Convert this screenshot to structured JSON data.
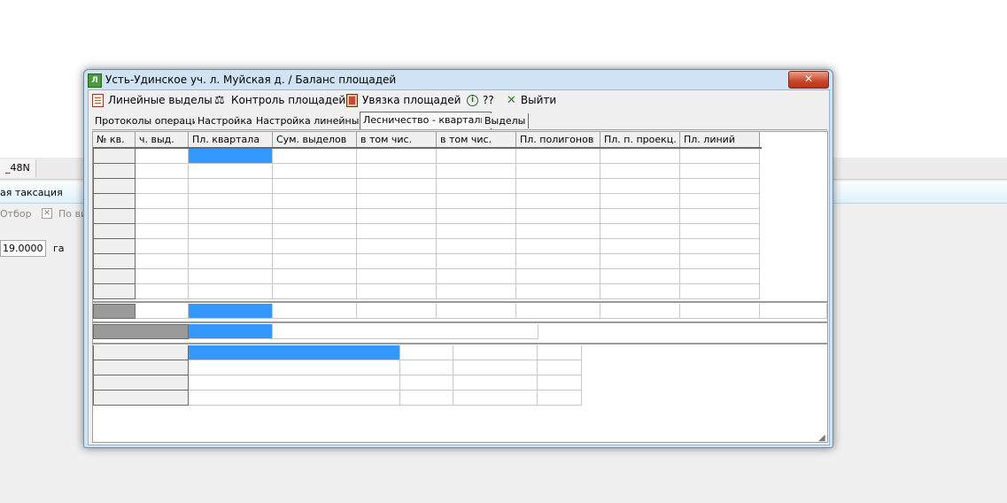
{
  "background": {
    "tab_label": "_48N",
    "bar_label": "ая таксация",
    "filter_label": "Отбор",
    "filter_check_label": "По ви",
    "area_value": "19.0000",
    "area_unit": "га"
  },
  "window": {
    "title": "Усть-Удинское уч. л. Муйская д. / Баланс площадей",
    "close_glyph": "✕",
    "menu": [
      {
        "label": "Линейные выделы",
        "icon": "document-icon"
      },
      {
        "label": "Контроль площадей",
        "icon": "scales-icon"
      },
      {
        "label": "Увязка площадей",
        "icon": "ledger-icon"
      },
      {
        "label": "??",
        "icon": "info-icon"
      },
      {
        "label": "Выйти",
        "icon": "exit-x-icon"
      }
    ],
    "tabs": [
      {
        "label": "Протоколы операций"
      },
      {
        "label": "Настройка"
      },
      {
        "label": "Настройка линейных"
      },
      {
        "label": "Лесничество - кварталы",
        "active": true
      },
      {
        "label": "Выделы"
      }
    ],
    "columns": [
      "№ кв.",
      "ч. выд.",
      "Пл. квартала",
      "Сум. выделов",
      "в том чис. лин.",
      "в том чис. прот",
      "Пл. полигонов",
      "Пл. п. проекц.",
      "Пл. линий"
    ],
    "accent_color": "#3399ff"
  }
}
